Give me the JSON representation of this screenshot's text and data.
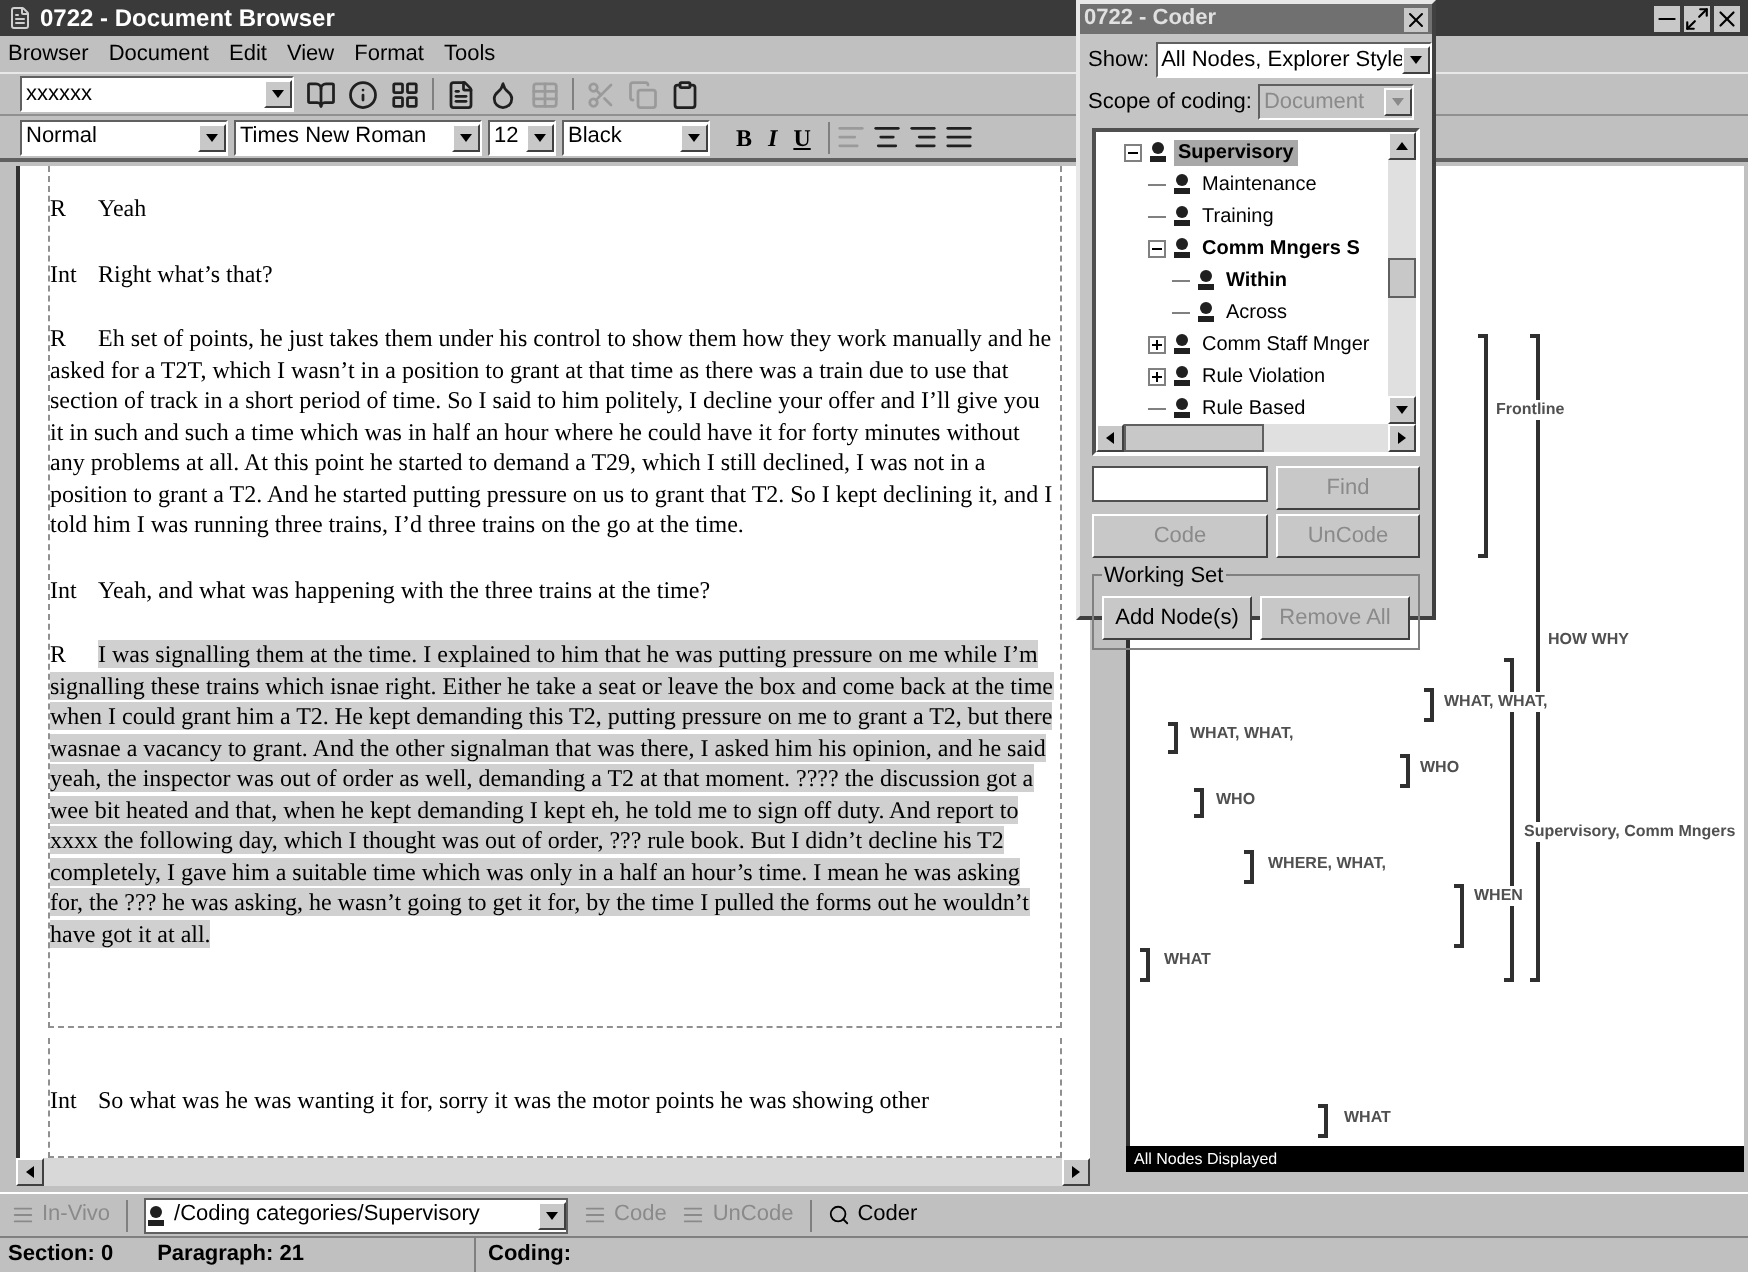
{
  "window": {
    "title": "0722 - Document Browser"
  },
  "menu": [
    "Browser",
    "Document",
    "Edit",
    "View",
    "Format",
    "Tools"
  ],
  "toolbar": {
    "document_combo": "xxxxxx"
  },
  "format_bar": {
    "style": "Normal",
    "font": "Times New Roman",
    "size": "12",
    "font_color_combo": "Black",
    "text_buttons": [
      "B",
      "I",
      "U"
    ]
  },
  "document": {
    "sections": [
      {
        "paragraphs": [
          {
            "speaker": "R",
            "text": "Yeah",
            "highlighted": false
          },
          {
            "speaker": "Int",
            "text": "Right what’s that?",
            "highlighted": false
          },
          {
            "speaker": "R",
            "text": "Eh set of points, he just takes them under his control to show them how they work manually and he asked for a T2T, which I wasn’t in a position to grant at that time as there was a train due to use that section of track in a short period of time.  So I said to him politely, I decline your offer and I’ll give you it in such and such a time which was in half an hour where he could have it for forty minutes without any problems at all.  At this point he started to demand a T29, which I still declined, I was not in a position to grant a T2.  And he started putting pressure on us to grant that T2.  So I kept declining it, and I told him I was running three trains, I’d three trains on the go at the time.",
            "highlighted": false
          },
          {
            "speaker": "Int",
            "text": "Yeah, and what was happening with the three trains at the time?",
            "highlighted": false
          },
          {
            "speaker": "R",
            "text": "I was signalling them at the time.  I explained to him that he was putting pressure on me while I’m signalling these trains which isnae right.  Either he take a seat or leave the box and come back at the time when I could grant him a T2.  He kept demanding this T2, putting pressure on me to grant a T2, but there wasnae a vacancy to grant.  And the other signalman that was there, I asked him his opinion, and he said yeah, the inspector was out of order as well, demanding a T2 at that moment. ???? the discussion got a wee bit heated and that, when he kept demanding I kept eh, he told me to sign off duty.  And report to xxxx the following day, which I thought was out of order, ??? rule book. But I didn’t decline his T2 completely, I gave him a suitable time which was only in a half an hour’s time.  I mean he was asking for, the ??? he was asking, he wasn’t going to get it for, by the time I pulled the forms out he wouldn’t have got it at all.",
            "highlighted": true
          }
        ]
      },
      {
        "paragraphs": [
          {
            "speaker": "Int",
            "text": "So what was he was wanting it for, sorry it was the motor points he was showing other",
            "highlighted": false
          }
        ]
      }
    ]
  },
  "coding_stripes": {
    "stripes": [
      {
        "label": "Frontline"
      },
      {
        "label": "HOW WHY"
      },
      {
        "label": "WHAT, WHAT,"
      },
      {
        "label": "WHAT, WHAT,"
      },
      {
        "label": "WHO"
      },
      {
        "label": "WHO"
      },
      {
        "label": "Supervisory, Comm Mngers"
      },
      {
        "label": "WHERE, WHAT,"
      },
      {
        "label": "WHEN"
      },
      {
        "label": "WHAT"
      },
      {
        "label": "WHAT"
      }
    ],
    "status": "All Nodes Displayed"
  },
  "coder": {
    "title": "0722 - Coder",
    "show_label": "Show:",
    "show_value": "All Nodes, Explorer Style",
    "scope_label": "Scope of coding:",
    "scope_value": "Document",
    "scope_disabled": true,
    "tree": [
      {
        "label": "Supervisory",
        "kind": "node",
        "expanded": true,
        "bold": true,
        "selected": true,
        "children": [
          {
            "label": "Maintenance",
            "kind": "leaf",
            "bold": false,
            "selected": false
          },
          {
            "label": "Training",
            "kind": "leaf",
            "bold": false,
            "selected": false
          },
          {
            "label": "Comm Mngers S",
            "kind": "node",
            "expanded": true,
            "bold": true,
            "selected": false,
            "children": [
              {
                "label": "Within",
                "kind": "leaf",
                "bold": true,
                "selected": false
              },
              {
                "label": "Across",
                "kind": "leaf",
                "bold": false,
                "selected": false
              }
            ]
          },
          {
            "label": "Comm Staff Mnger",
            "kind": "node",
            "expanded": false,
            "bold": false,
            "selected": false
          },
          {
            "label": "Rule Violation",
            "kind": "node",
            "expanded": false,
            "bold": false,
            "selected": false
          },
          {
            "label": "Rule Based",
            "kind": "leaf",
            "bold": false,
            "selected": false
          }
        ]
      }
    ],
    "find_button": {
      "label": "Find",
      "disabled": true
    },
    "code_button": {
      "label": "Code",
      "disabled": true
    },
    "uncode_button": {
      "label": "UnCode",
      "disabled": true
    },
    "working_set": {
      "title": "Working Set",
      "buttons": [
        {
          "label": "Add Node(s)",
          "disabled": false
        },
        {
          "label": "Remove All",
          "disabled": true
        }
      ]
    }
  },
  "bottom_toolbar": {
    "invivo": {
      "label": "In-Vivo",
      "disabled": true
    },
    "node_combo": "/Coding categories/Supervisory",
    "code": {
      "label": "Code",
      "disabled": true
    },
    "uncode": {
      "label": "UnCode",
      "disabled": true
    },
    "coder": {
      "label": "Coder",
      "disabled": false
    }
  },
  "status_bar": {
    "section": "Section: 0",
    "paragraph": "Paragraph: 21",
    "coding": "Coding:"
  }
}
